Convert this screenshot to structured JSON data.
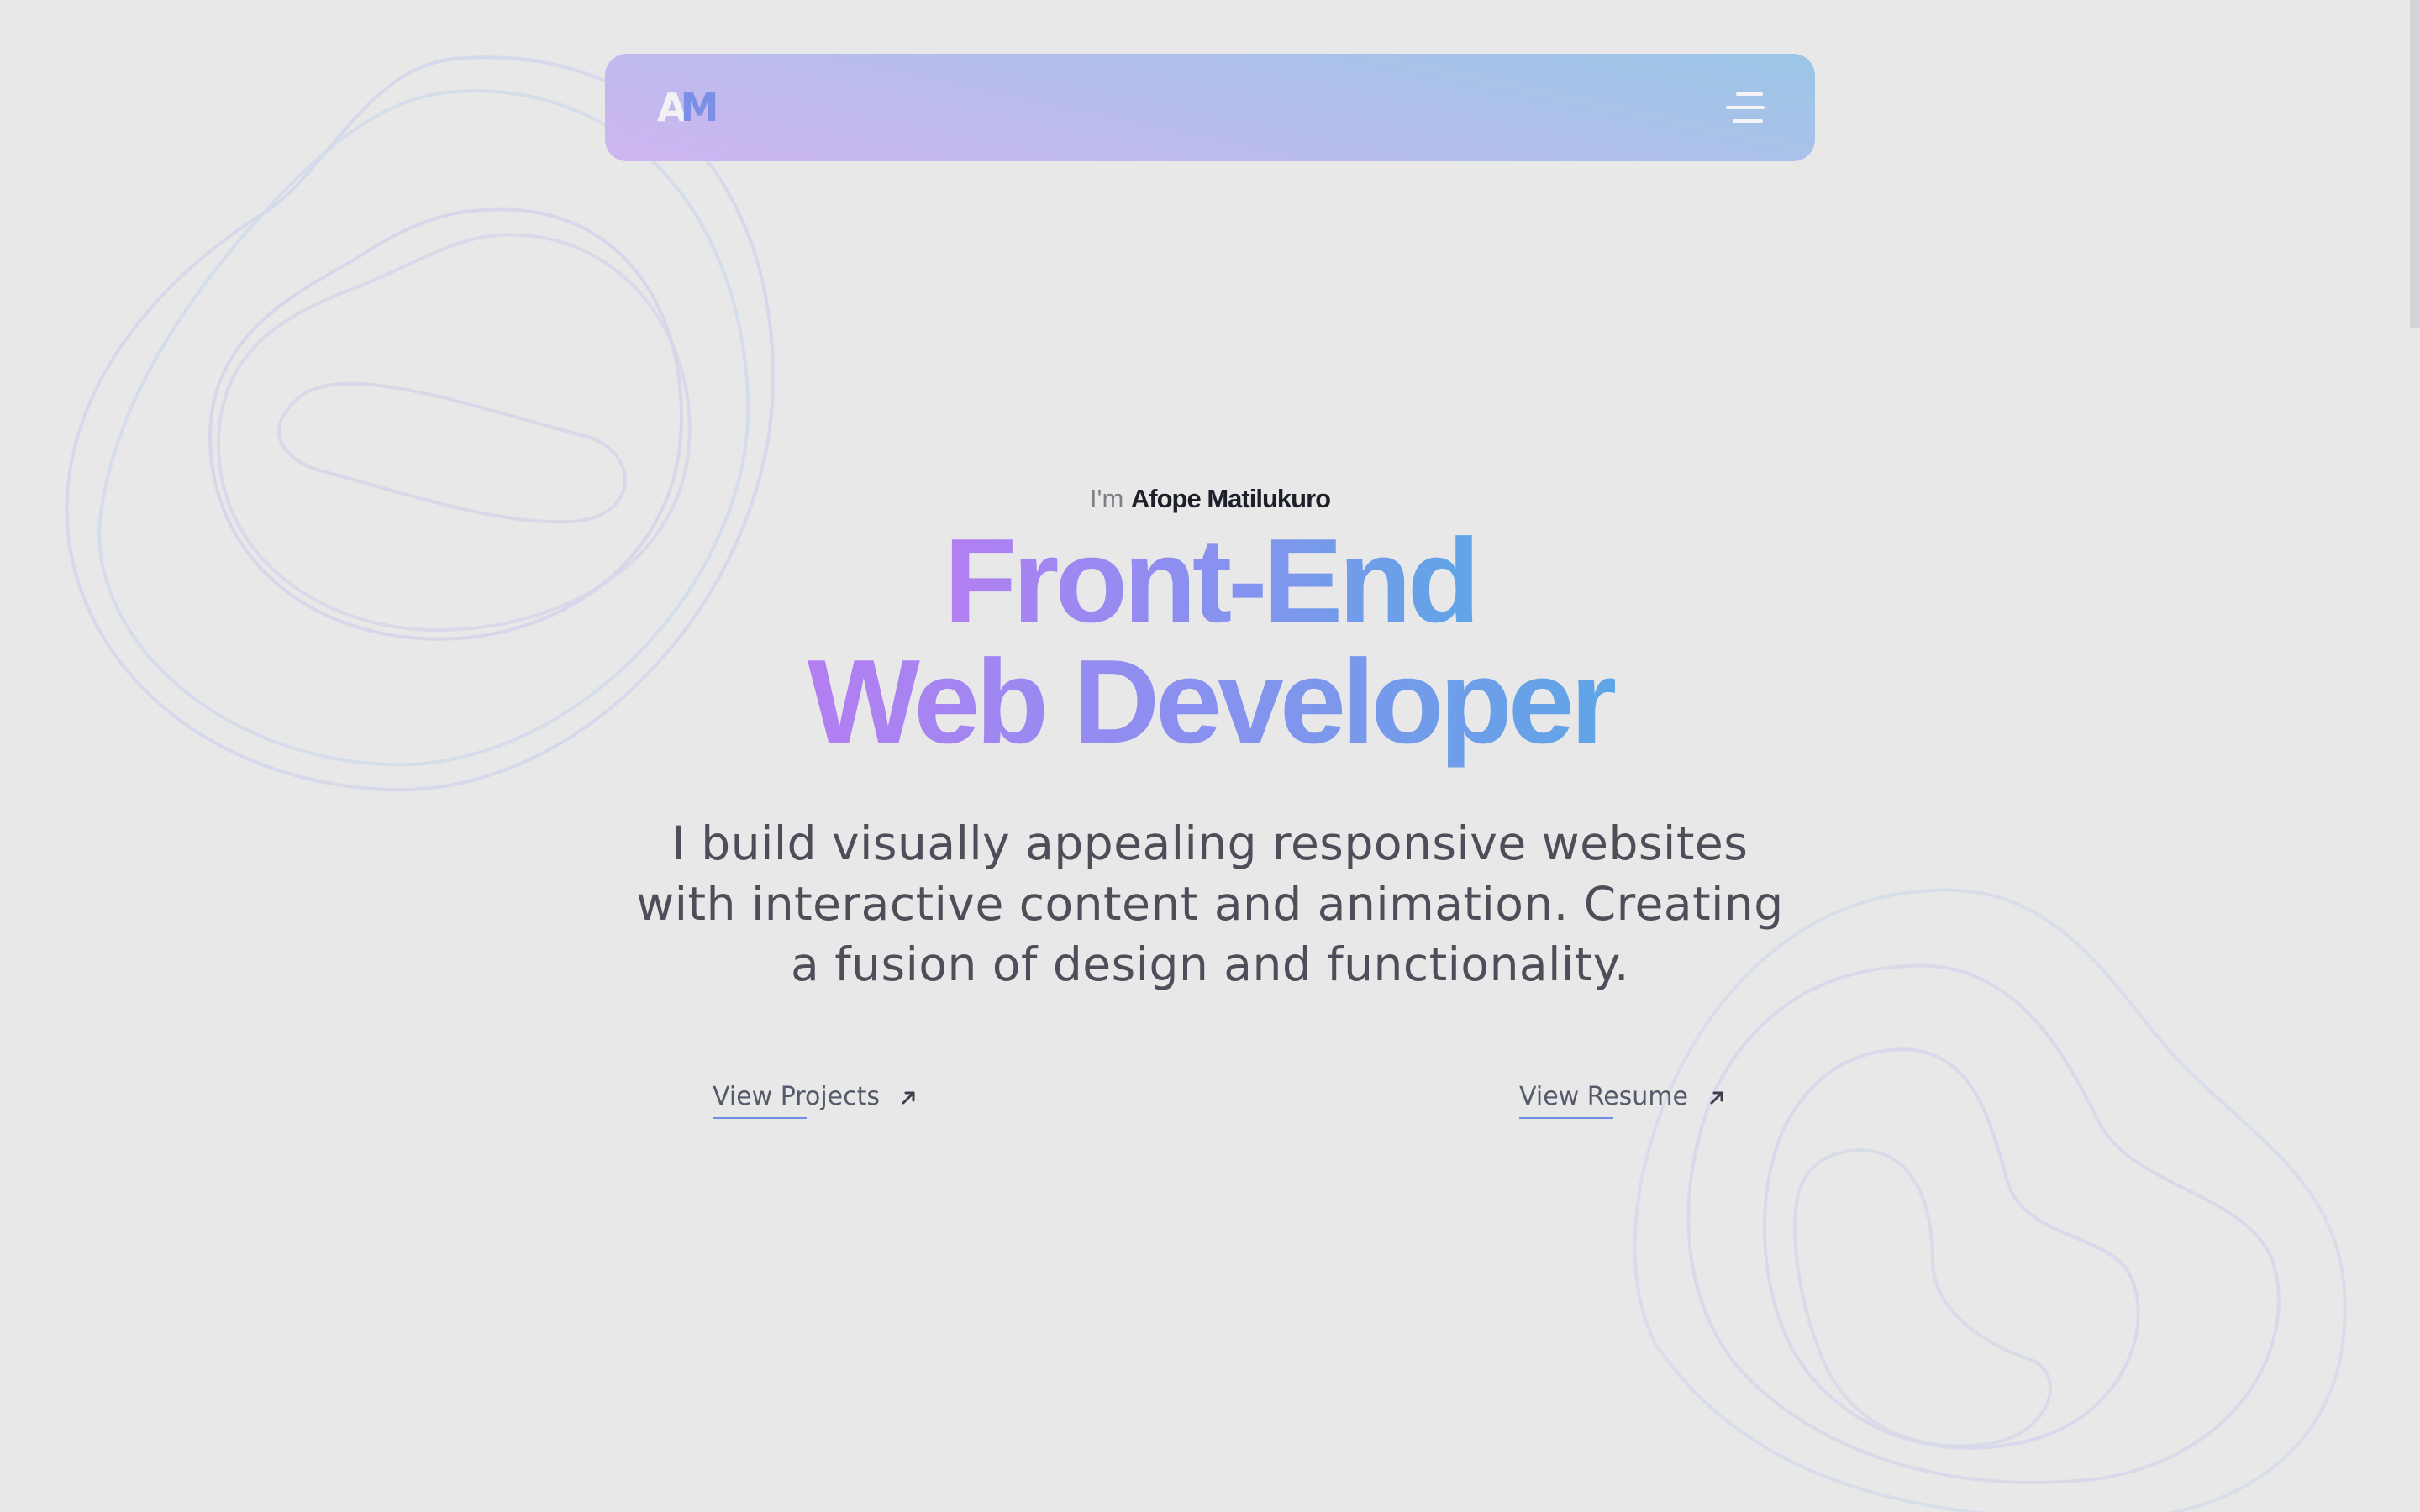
{
  "header": {
    "logo": {
      "letter_1": "A",
      "letter_2": "M"
    },
    "menu_icon": "hamburger-menu-icon"
  },
  "hero": {
    "intro_prefix": "I'm",
    "name": "Afope Matilukuro",
    "headline_line_1": "Front-End",
    "headline_line_2": "Web Developer",
    "description": "I build visually appealing responsive websites with interactive content and animation. Creating a fusion of design and functionality."
  },
  "actions": {
    "projects_label": "View Projects",
    "resume_label": "View Resume",
    "arrow_icon": "arrow-up-right-icon"
  },
  "colors": {
    "background": "#e8e8e8",
    "navbar_gradient_start": "#ceb5f1",
    "navbar_gradient_end": "#9ac6e6",
    "headline_gradient_start": "#b47ef2",
    "headline_gradient_end": "#5ea6e6",
    "accent_underline": "#6f8ee6",
    "name_color": "#1d1f29",
    "body_text": "#4d4e58"
  }
}
